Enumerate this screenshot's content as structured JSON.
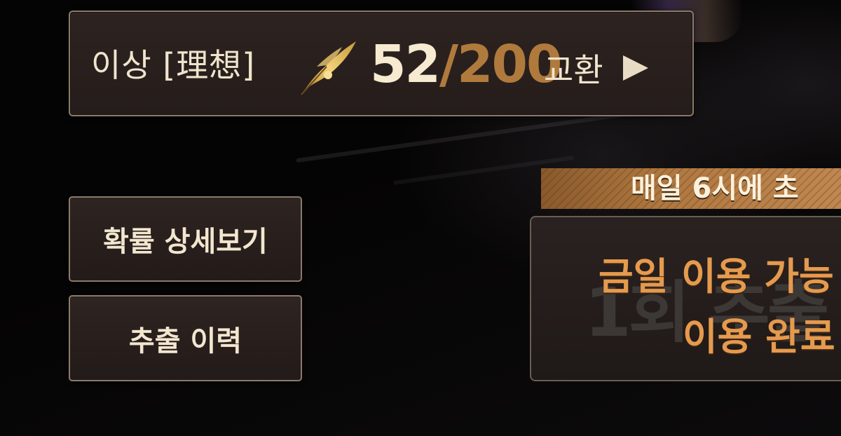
{
  "currency": {
    "name": "이상 [理想]",
    "current": "52",
    "separator": "/",
    "max": "200",
    "icon": "golden-feather-icon",
    "exchange_label": "교환",
    "exchange_icon": "play-triangle-icon"
  },
  "buttons": {
    "probability": "확률 상세보기",
    "history": "추출 이력"
  },
  "daily": {
    "reset_banner": "매일 6시에 초",
    "watermark": "1회 추출",
    "line1": "금일 이용 가능",
    "line2": "이용 완료"
  },
  "colors": {
    "accent_gold": "#b07a3c",
    "text_cream": "#f1e4cd",
    "panel_border": "#8a7a6a",
    "usage_orange": "#e59a4e"
  }
}
